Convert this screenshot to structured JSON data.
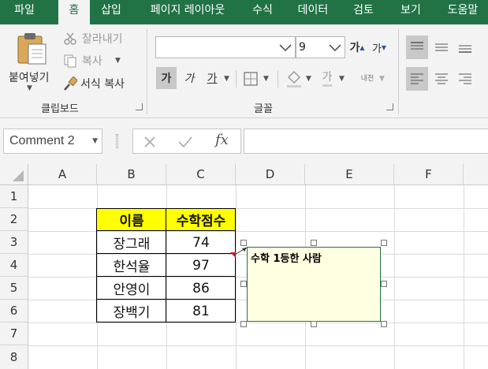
{
  "tabs": [
    "파일",
    "홈",
    "삽입",
    "페이지 레이아웃",
    "수식",
    "데이터",
    "검토",
    "보기",
    "도움말"
  ],
  "active_tab": "홈",
  "clipboard": {
    "paste_label": "붙여넣기",
    "cut_label": "잘라내기",
    "copy_label": "복사",
    "format_painter_label": "서식 복사",
    "group_label": "클립보드"
  },
  "font": {
    "font_name_value": "",
    "font_size_value": "9",
    "grow_label": "가",
    "shrink_label": "가",
    "bold_label": "가",
    "italic_label": "가",
    "underline_label": "가",
    "font_color_label": "가",
    "phonetic_label": "내천",
    "group_label": "글꼴"
  },
  "formula_bar": {
    "name_box_value": "Comment 2",
    "fx_label": "fx",
    "formula_value": ""
  },
  "columns": [
    "A",
    "B",
    "C",
    "D",
    "E",
    "F"
  ],
  "rows": [
    "1",
    "2",
    "3",
    "4",
    "5",
    "6",
    "7",
    "8"
  ],
  "table": {
    "headers": [
      "이름",
      "수학점수"
    ],
    "rows": [
      [
        "장그래",
        "74"
      ],
      [
        "한석율",
        "97"
      ],
      [
        "안영이",
        "86"
      ],
      [
        "장백기",
        "81"
      ]
    ]
  },
  "comment": {
    "text": "수학 1등한 사람"
  },
  "colors": {
    "ribbon_green": "#217346",
    "header_fill": "#ffff00",
    "comment_fill": "#ffffe1",
    "indicator_red": "#e81123"
  },
  "icons": {
    "paste": "clipboard-paste-icon",
    "cut": "scissors-icon",
    "copy": "copy-icon",
    "format_painter": "paintbrush-icon",
    "borders": "borders-icon",
    "fill_color": "fill-bucket-icon",
    "cancel": "x-icon",
    "enter": "checkmark-icon",
    "insert_function": "fx-icon"
  }
}
